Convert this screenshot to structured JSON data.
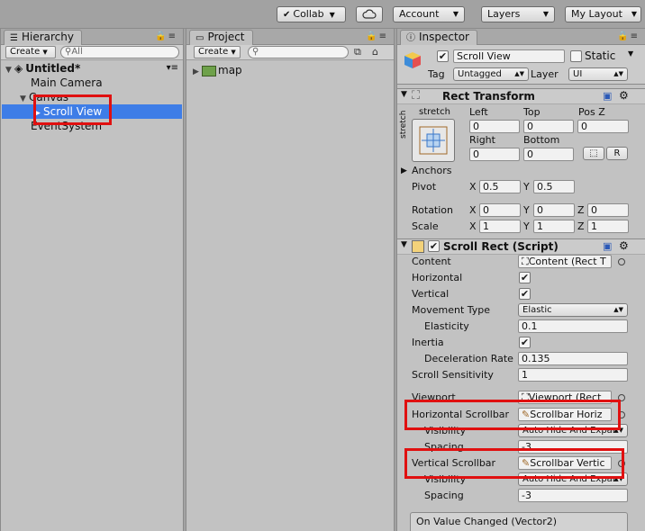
{
  "toolbar": {
    "collab": "Collab",
    "account": "Account",
    "layers": "Layers",
    "layout": "My Layout"
  },
  "hierarchy": {
    "tab": "Hierarchy",
    "create": "Create",
    "search_placeholder": "All",
    "scene": "Untitled*",
    "items": [
      "Main Camera",
      "Canvas",
      "Scroll View",
      "EventSystem"
    ]
  },
  "project": {
    "tab": "Project",
    "create": "Create",
    "assets": [
      "map"
    ]
  },
  "inspector": {
    "tab": "Inspector",
    "object_name": "Scroll View",
    "static_label": "Static",
    "tag_label": "Tag",
    "tag_value": "Untagged",
    "layer_label": "Layer",
    "layer_value": "UI",
    "rect_transform": {
      "title": "Rect Transform",
      "anchor_top": "stretch",
      "anchor_side": "stretch",
      "left_label": "Left",
      "top_label": "Top",
      "posz_label": "Pos Z",
      "left": "0",
      "top": "0",
      "posz": "0",
      "right_label": "Right",
      "bottom_label": "Bottom",
      "right": "0",
      "bottom": "0",
      "r_button": "R",
      "anchors": "Anchors",
      "pivot": "Pivot",
      "pivot_x": "0.5",
      "pivot_y": "0.5",
      "rotation": "Rotation",
      "rot_x": "0",
      "rot_y": "0",
      "rot_z": "0",
      "scale": "Scale",
      "scale_x": "1",
      "scale_y": "1",
      "scale_z": "1",
      "x": "X",
      "y": "Y",
      "z": "Z"
    },
    "scroll_rect": {
      "title": "Scroll Rect (Script)",
      "content_label": "Content",
      "content_value": "Content (Rect T",
      "horizontal": "Horizontal",
      "vertical": "Vertical",
      "movement_type": "Movement Type",
      "movement_value": "Elastic",
      "elasticity": "Elasticity",
      "elasticity_value": "0.1",
      "inertia": "Inertia",
      "deceleration": "Deceleration Rate",
      "deceleration_value": "0.135",
      "sensitivity": "Scroll Sensitivity",
      "sensitivity_value": "1",
      "viewport": "Viewport",
      "viewport_value": "Viewport (Rect",
      "h_scrollbar": "Horizontal Scrollbar",
      "h_scrollbar_value": "Scrollbar Horiz",
      "visibility": "Visibility",
      "visibility_value": "Auto Hide And Expar",
      "spacing": "Spacing",
      "h_spacing_value": "-3",
      "v_scrollbar": "Vertical Scrollbar",
      "v_scrollbar_value": "Scrollbar Vertic",
      "v_visibility_value": "Auto Hide And Expar",
      "v_spacing_value": "-3",
      "on_value_changed": "On Value Changed (Vector2)"
    }
  }
}
